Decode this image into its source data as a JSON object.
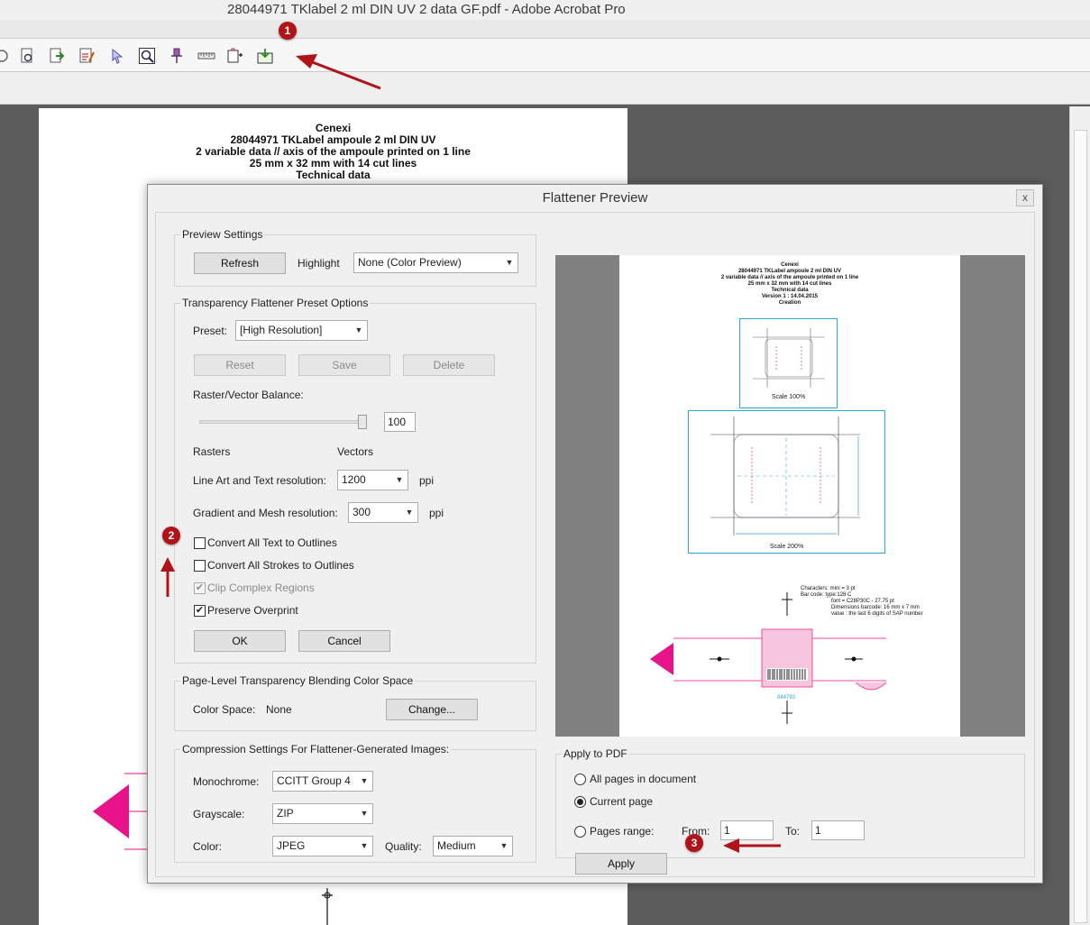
{
  "window": {
    "title": "28044971 TKlabel 2 ml DIN UV 2 data GF.pdf - Adobe Acrobat Pro"
  },
  "toolbar": {
    "icons": [
      "magnify-document-icon",
      "find-icon",
      "export-icon",
      "edit-pen-icon",
      "select-arrow-icon",
      "preview-zoom-icon",
      "pushpin-icon",
      "ruler-icon",
      "object-tools-icon",
      "flattener-preview-icon"
    ]
  },
  "document": {
    "header": [
      "Cenexi",
      "28044971 TKLabel ampoule 2 ml DIN UV",
      "2 variable data // axis of the ampoule printed on 1 line",
      "25 mm x 32 mm with 14 cut lines",
      "Technical data"
    ]
  },
  "annotations": {
    "badge1": "1",
    "badge2": "2",
    "badge3": "3"
  },
  "dialog": {
    "title": "Flattener Preview",
    "close_label": "x",
    "preview_settings": {
      "legend": "Preview Settings",
      "refresh_label": "Refresh",
      "highlight_label": "Highlight",
      "highlight_value": "None (Color Preview)"
    },
    "preset_options": {
      "legend": "Transparency Flattener Preset Options",
      "preset_label": "Preset:",
      "preset_value": "[High Resolution]",
      "reset_label": "Reset",
      "save_label": "Save",
      "delete_label": "Delete",
      "balance_label": "Raster/Vector Balance:",
      "balance_value": "100",
      "balance_level": 100,
      "rasters_label": "Rasters",
      "vectors_label": "Vectors",
      "line_art_label": "Line Art and Text resolution:",
      "line_art_value": "1200",
      "gradient_label": "Gradient and Mesh resolution:",
      "gradient_value": "300",
      "ppi_label": "ppi",
      "convert_text_label": "Convert All Text to Outlines",
      "convert_strokes_label": "Convert All Strokes to Outlines",
      "clip_label": "Clip Complex Regions",
      "overprint_label": "Preserve Overprint",
      "check_mark": "✔",
      "ok_label": "OK",
      "cancel_label": "Cancel"
    },
    "blending": {
      "legend": "Page-Level Transparency Blending Color Space",
      "color_space_label": "Color Space:",
      "color_space_value": "None",
      "change_label": "Change..."
    },
    "compression": {
      "legend": "Compression Settings For Flattener-Generated Images:",
      "mono_label": "Monochrome:",
      "mono_value": "CCITT Group 4",
      "gray_label": "Grayscale:",
      "gray_value": "ZIP",
      "color_label": "Color:",
      "color_value": "JPEG",
      "quality_label": "Quality:",
      "quality_value": "Medium"
    },
    "preview": {
      "header": [
        "Cenexi",
        "28044971 TKLabel ampoule 2 ml DIN UV",
        "2 variable data // axis of the ampoule printed on 1 line",
        "25 mm x 32 mm with 14 cut lines",
        "Technical data",
        "Version 1 : 14.04.2015",
        "Creation"
      ],
      "scale1": "Scale 100%",
      "scale2": "Scale 200%",
      "specs": [
        "Characters: mini = 3 pt",
        "Bar code:   type:128 C",
        "font = C28P30C - 27.75 pt",
        "Dimensions barcode: 16 mm x 7 mm",
        "value : the last 6 digits of SAP number"
      ],
      "barcode_number": "844793"
    },
    "apply_to_pdf": {
      "legend": "Apply to PDF",
      "all_pages_label": "All pages in document",
      "current_page_label": "Current page",
      "range_label": "Pages range:",
      "from_label": "From:",
      "from_value": "1",
      "to_label": "To:",
      "to_value": "1",
      "apply_label": "Apply"
    }
  }
}
